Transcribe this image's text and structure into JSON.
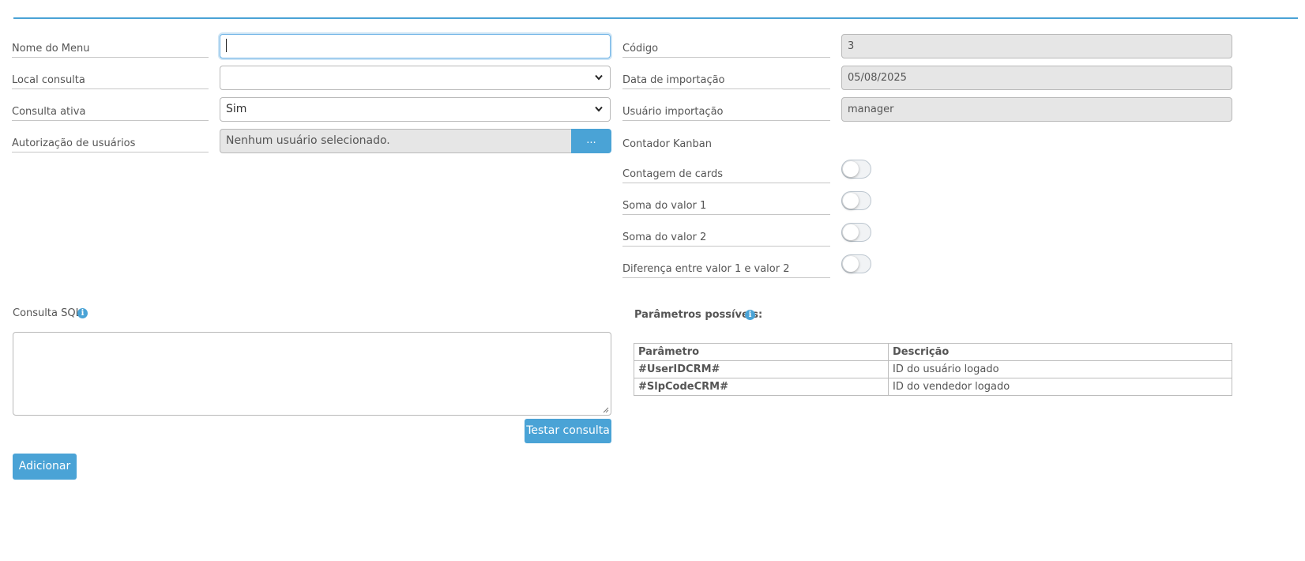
{
  "form": {
    "menu_name_label": "Nome do Menu",
    "menu_name_value": "",
    "local_label": "Local consulta",
    "local_value": "",
    "active_label": "Consulta ativa",
    "active_value": "Sim",
    "auth_label": "Autorização de usuários",
    "auth_value": "Nenhum usuário selecionado.",
    "auth_button": "...",
    "code_label": "Código",
    "code_value": "3",
    "import_date_label": "Data de importação",
    "import_date_value": "05/08/2025",
    "import_user_label": "Usuário importação",
    "import_user_value": "manager"
  },
  "kanban": {
    "heading": "Contador Kanban",
    "toggles": [
      {
        "label": "Contagem de cards",
        "on": false
      },
      {
        "label": "Soma do valor 1",
        "on": false
      },
      {
        "label": "Soma do valor 2",
        "on": false
      },
      {
        "label": "Diferença entre valor 1 e valor 2",
        "on": false
      }
    ]
  },
  "sql": {
    "label": "Consulta SQL",
    "value": "",
    "test_button": "Testar consulta"
  },
  "params": {
    "heading": "Parâmetros possíveis:",
    "columns": [
      "Parâmetro",
      "Descrição"
    ],
    "rows": [
      [
        "#UserIDCRM#",
        "ID do usuário logado"
      ],
      [
        "#SlpCodeCRM#",
        "ID do vendedor logado"
      ]
    ]
  },
  "actions": {
    "add_button": "Adicionar"
  },
  "colors": {
    "accent": "#4aa3d6",
    "readonly_bg": "#e6e6e6"
  },
  "icons": {
    "info": "info-circle-icon",
    "dropdown": "chevron-down-icon"
  }
}
